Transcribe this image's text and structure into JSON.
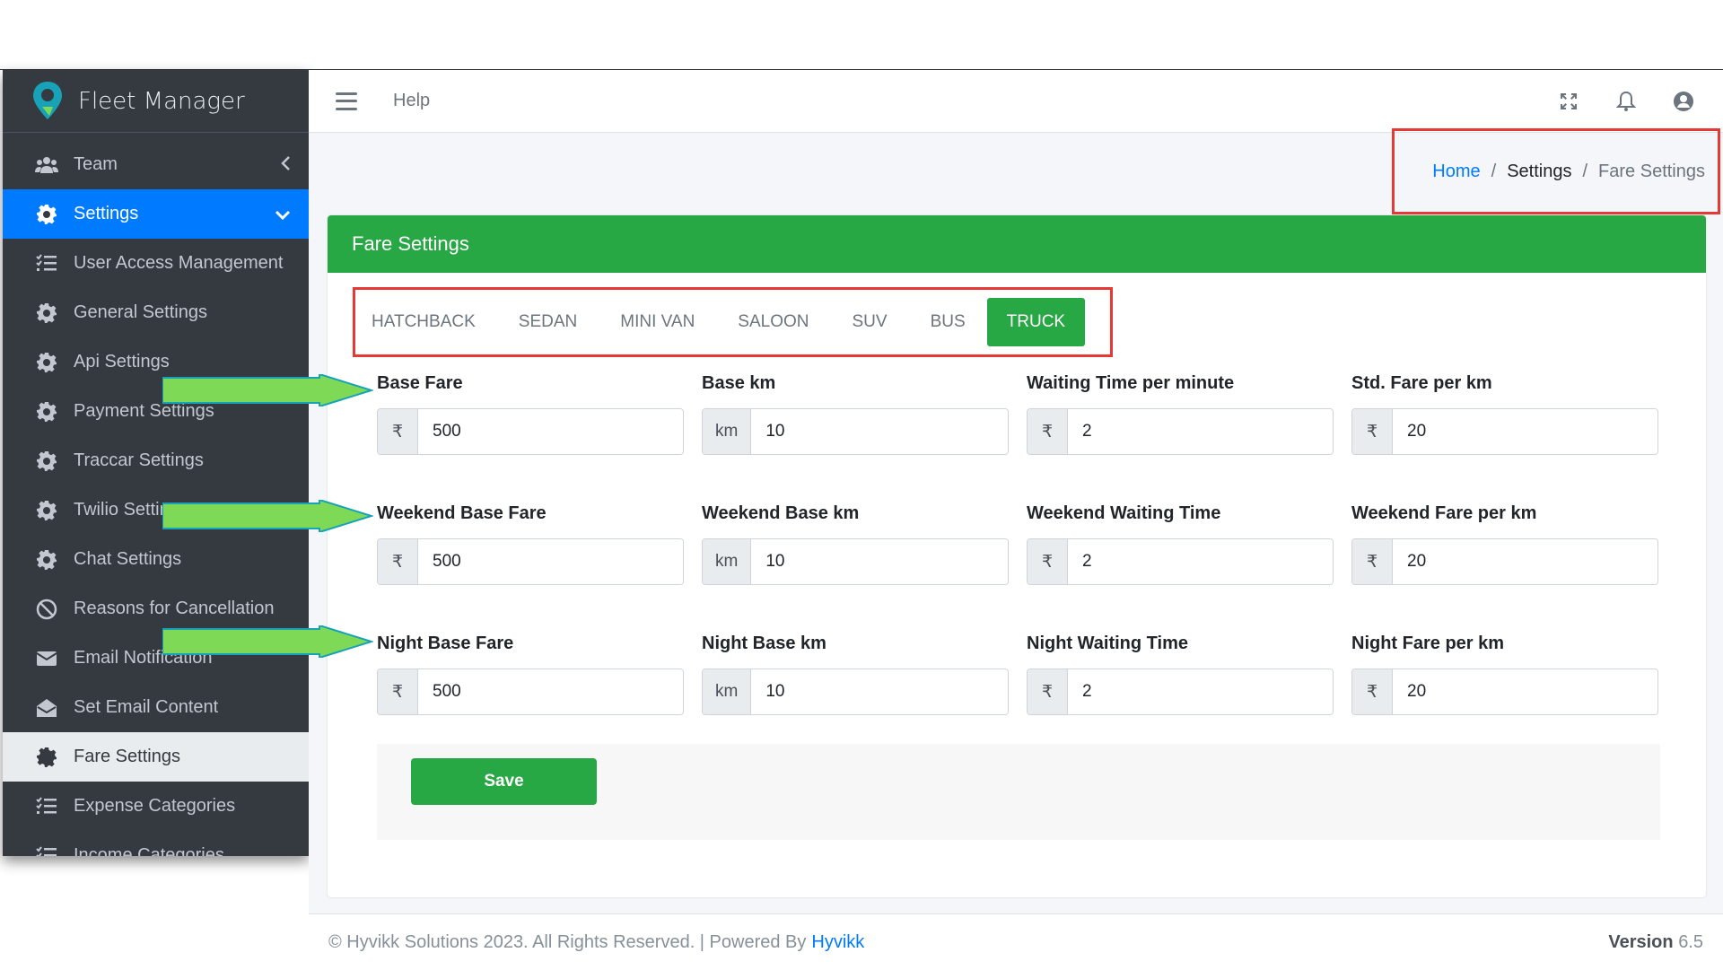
{
  "brand": {
    "name": "Fleet Manager"
  },
  "topbar": {
    "help_label": "Help"
  },
  "sidebar": {
    "items": [
      {
        "label": "Team",
        "icon": "users-icon",
        "state": "collapsed"
      },
      {
        "label": "Settings",
        "icon": "gear-icon",
        "state": "active"
      },
      {
        "label": "User Access Management",
        "icon": "list-check-icon"
      },
      {
        "label": "General Settings",
        "icon": "gear-icon"
      },
      {
        "label": "Api Settings",
        "icon": "gear-icon"
      },
      {
        "label": "Payment Settings",
        "icon": "gear-icon"
      },
      {
        "label": "Traccar Settings",
        "icon": "gear-icon"
      },
      {
        "label": "Twilio Settings",
        "icon": "gear-icon"
      },
      {
        "label": "Chat Settings",
        "icon": "gear-icon"
      },
      {
        "label": "Reasons for Cancellation",
        "icon": "ban-icon"
      },
      {
        "label": "Email Notification",
        "icon": "envelope-icon"
      },
      {
        "label": "Set Email Content",
        "icon": "envelope-open-icon"
      },
      {
        "label": "Fare Settings",
        "icon": "gear-icon",
        "state": "current"
      },
      {
        "label": "Expense Categories",
        "icon": "list-check-icon"
      },
      {
        "label": "Income Categories",
        "icon": "list-check-icon"
      }
    ]
  },
  "breadcrumb": {
    "home": "Home",
    "settings": "Settings",
    "current": "Fare Settings",
    "separator": "/"
  },
  "card": {
    "title": "Fare Settings"
  },
  "tabs": [
    "HATCHBACK",
    "SEDAN",
    "MINI VAN",
    "SALOON",
    "SUV",
    "BUS",
    "TRUCK"
  ],
  "active_tab": "TRUCK",
  "fields": [
    [
      {
        "label": "Base Fare",
        "prefix": "₹",
        "value": "500"
      },
      {
        "label": "Base km",
        "prefix": "km",
        "value": "10"
      },
      {
        "label": "Waiting Time per minute",
        "prefix": "₹",
        "value": "2"
      },
      {
        "label": "Std. Fare per km",
        "prefix": "₹",
        "value": "20"
      }
    ],
    [
      {
        "label": "Weekend Base Fare",
        "prefix": "₹",
        "value": "500"
      },
      {
        "label": "Weekend Base km",
        "prefix": "km",
        "value": "10"
      },
      {
        "label": "Weekend Waiting Time",
        "prefix": "₹",
        "value": "2"
      },
      {
        "label": "Weekend Fare per km",
        "prefix": "₹",
        "value": "20"
      }
    ],
    [
      {
        "label": "Night Base Fare",
        "prefix": "₹",
        "value": "500"
      },
      {
        "label": "Night Base km",
        "prefix": "km",
        "value": "10"
      },
      {
        "label": "Night Waiting Time",
        "prefix": "₹",
        "value": "2"
      },
      {
        "label": "Night Fare per km",
        "prefix": "₹",
        "value": "20"
      }
    ]
  ],
  "save_label": "Save",
  "footer": {
    "copyright": "© Hyvikk Solutions 2023. All Rights Reserved. | Powered By",
    "link": "Hyvikk",
    "version_label": "Version",
    "version": "6.5"
  },
  "colors": {
    "primary": "#007bff",
    "success": "#28a745",
    "sidebar": "#343a40",
    "highlight": "#e53935",
    "annotation_arrow": "#7ed957"
  }
}
